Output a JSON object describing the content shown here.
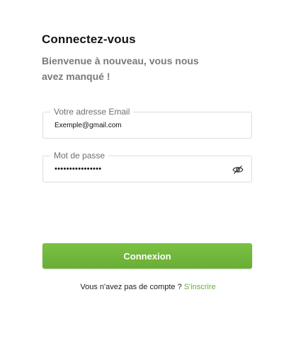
{
  "header": {
    "title": "Connectez-vous",
    "subtitle": "Bienvenue à nouveau, vous nous avez manqué !"
  },
  "form": {
    "email": {
      "label": "Votre adresse Email",
      "value": "Exemple@gmail.com"
    },
    "password": {
      "label": "Mot de passe",
      "value": "••••••••••••••••",
      "toggle_icon": "eye-off-icon"
    },
    "submit_label": "Connexion"
  },
  "footer": {
    "prompt": "Vous n'avez pas de compte ?",
    "signup_label": "S'inscrire"
  },
  "colors": {
    "accent": "#6aac3a",
    "button": "#72b83d",
    "text_muted": "#7a7a7a",
    "border": "#dcdcdc"
  }
}
